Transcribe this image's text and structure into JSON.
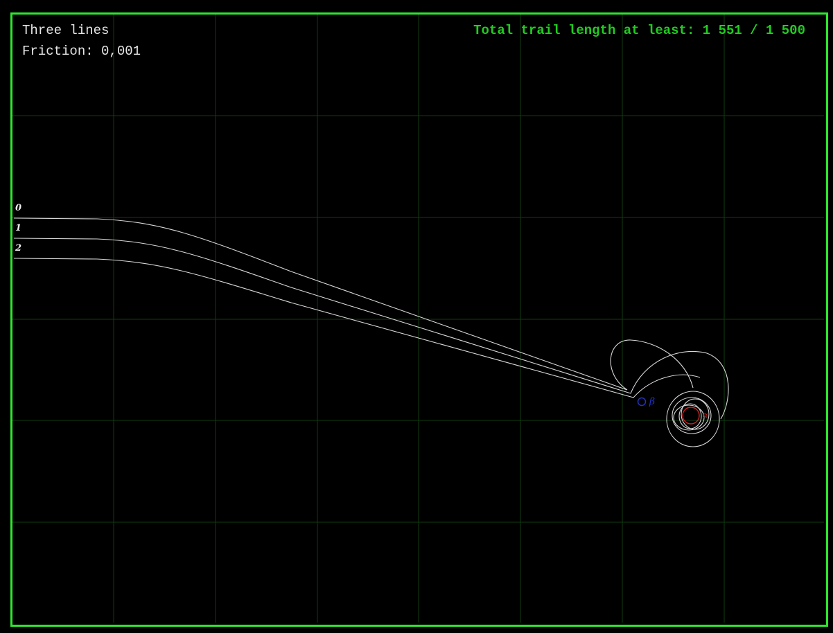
{
  "level": {
    "name": "Three lines",
    "friction_label": "Friction: 0,001"
  },
  "score": {
    "label": "Total trail length at least: 1 551 / 1 500"
  },
  "launch_lines": [
    {
      "label": "0"
    },
    {
      "label": "1"
    },
    {
      "label": "2"
    }
  ],
  "bodies": [
    {
      "symbol": "β",
      "color": "#2233cc"
    },
    {
      "symbol": "α",
      "color": "#cc2222"
    }
  ],
  "colors": {
    "border": "#2ee82e",
    "grid": "#0f3d0f",
    "trail": "#d8d8d8",
    "score_text": "#22cc22"
  }
}
